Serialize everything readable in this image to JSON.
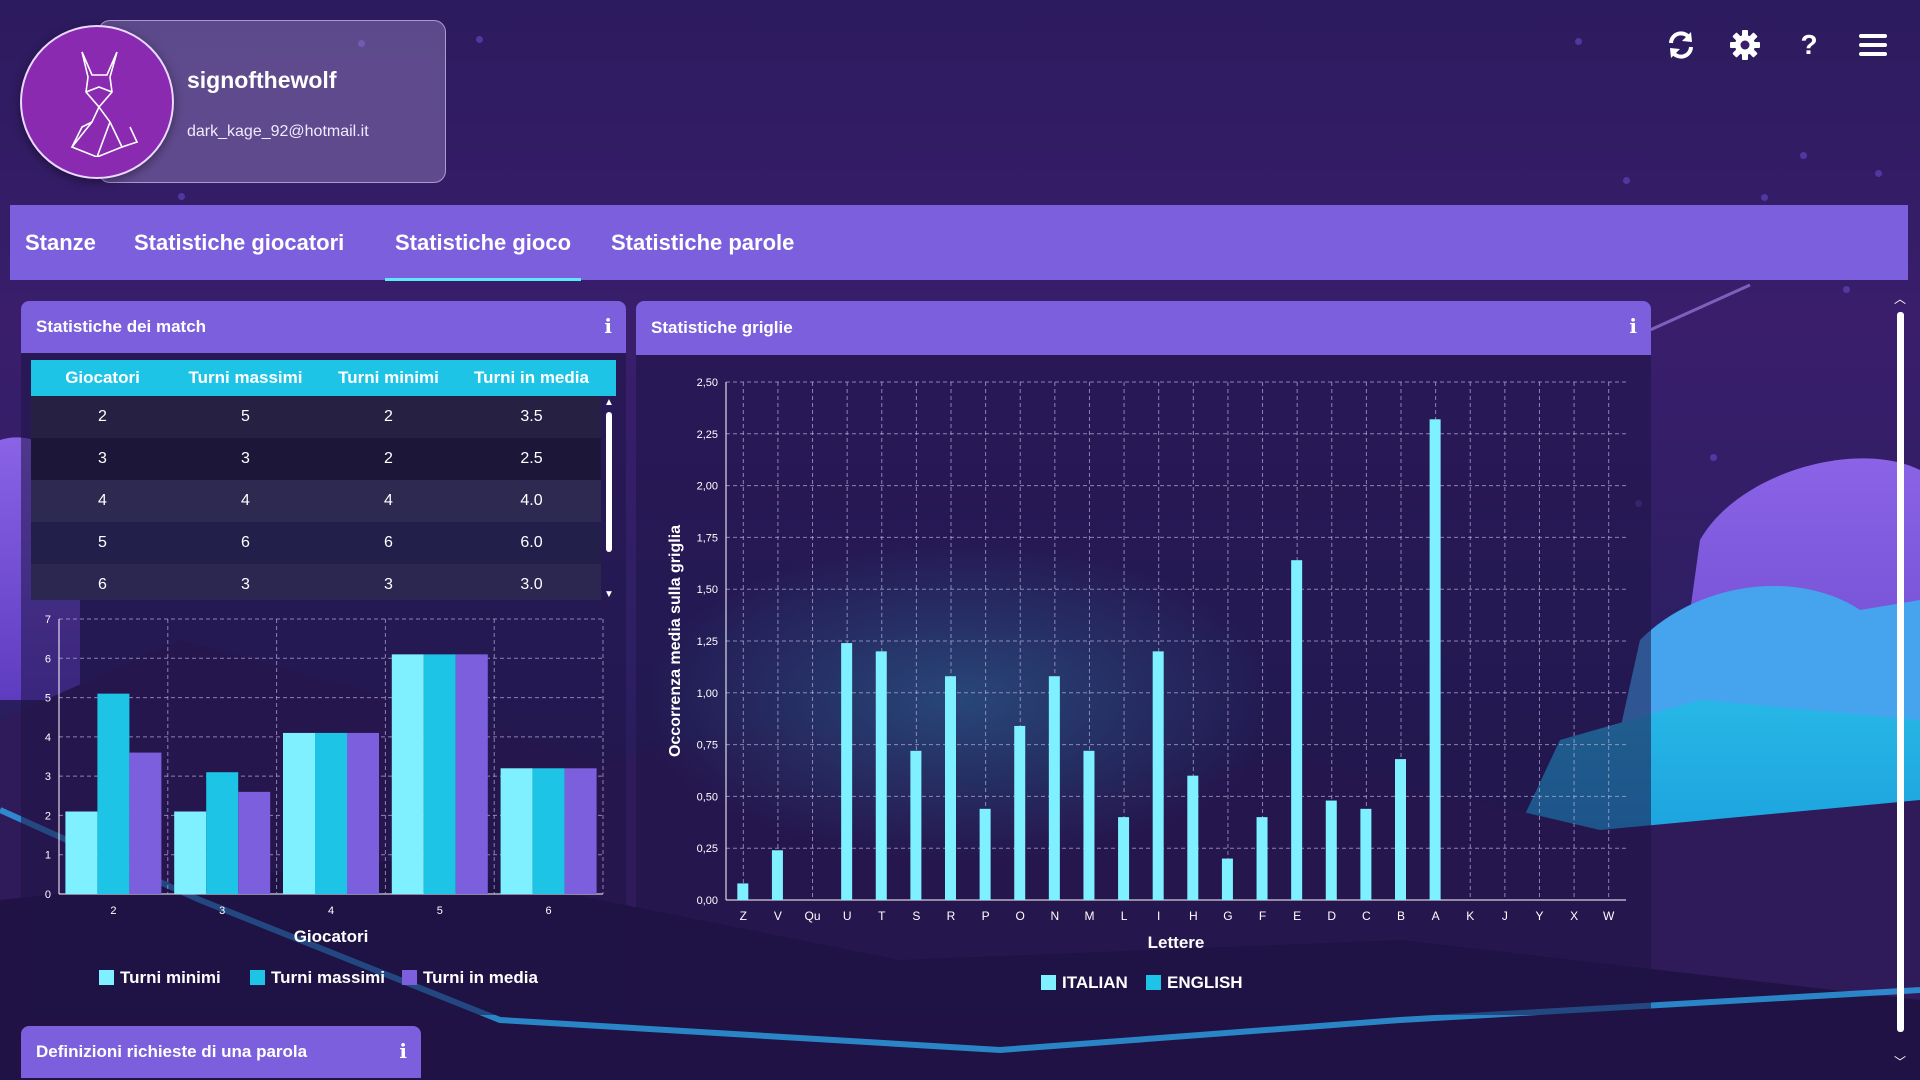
{
  "user": {
    "username": "signofthewolf",
    "email": "dark_kage_92@hotmail.it"
  },
  "top_icons": [
    "refresh-icon",
    "gear-icon",
    "help-icon",
    "menu-icon"
  ],
  "nav": {
    "tabs": [
      {
        "label": "Stanze"
      },
      {
        "label": "Statistiche giocatori"
      },
      {
        "label": "Statistiche gioco",
        "active": true
      },
      {
        "label": "Statistiche parole"
      }
    ]
  },
  "colors": {
    "nav_bg": "#7b5fdc",
    "cyan_light": "#7ff0ff",
    "cyan": "#1ec4e6",
    "purple": "#7b5fdc"
  },
  "match_panel": {
    "title": "Statistiche dei match",
    "info": "i",
    "table": {
      "headers": [
        "Giocatori",
        "Turni massimi",
        "Turni minimi",
        "Turni in media"
      ],
      "rows": [
        [
          "2",
          "5",
          "2",
          "3.5"
        ],
        [
          "3",
          "3",
          "2",
          "2.5"
        ],
        [
          "4",
          "4",
          "4",
          "4.0"
        ],
        [
          "5",
          "6",
          "6",
          "6.0"
        ],
        [
          "6",
          "3",
          "3",
          "3.0"
        ]
      ]
    }
  },
  "grid_panel": {
    "title": "Statistiche griglie",
    "info": "i"
  },
  "definitions_panel": {
    "title": "Definizioni richieste di una parola",
    "info": "i"
  },
  "chart_data": [
    {
      "type": "bar",
      "xlabel": "Giocatori",
      "ylabel": "",
      "ylim": [
        0,
        7
      ],
      "yticks": [
        0,
        1,
        2,
        3,
        4,
        5,
        6,
        7
      ],
      "categories": [
        "2",
        "3",
        "4",
        "5",
        "6"
      ],
      "series": [
        {
          "name": "Turni minimi",
          "color": "#7ff0ff",
          "values": [
            2.1,
            2.1,
            4.1,
            6.1,
            3.2
          ]
        },
        {
          "name": "Turni massimi",
          "color": "#1ec4e6",
          "values": [
            5.1,
            3.1,
            4.1,
            6.1,
            3.2
          ]
        },
        {
          "name": "Turni in media",
          "color": "#7b5fdc",
          "values": [
            3.6,
            2.6,
            4.1,
            6.1,
            3.2
          ]
        }
      ],
      "grid": true,
      "legend": "bottom"
    },
    {
      "type": "bar",
      "xlabel": "Lettere",
      "ylabel": "Occorrenza media sulla griglia",
      "ylim": [
        0,
        2.5
      ],
      "yticks": [
        "0,00",
        "0,25",
        "0,50",
        "0,75",
        "1,00",
        "1,25",
        "1,50",
        "1,75",
        "2,00",
        "2,25",
        "2,50"
      ],
      "categories": [
        "Z",
        "V",
        "Qu",
        "U",
        "T",
        "S",
        "R",
        "P",
        "O",
        "N",
        "M",
        "L",
        "I",
        "H",
        "G",
        "F",
        "E",
        "D",
        "C",
        "B",
        "A",
        "K",
        "J",
        "Y",
        "X",
        "W"
      ],
      "series": [
        {
          "name": "ITALIAN",
          "color": "#7ff0ff",
          "values": [
            0.08,
            0.24,
            0,
            1.24,
            1.2,
            0.72,
            1.08,
            0.44,
            0.84,
            1.08,
            0.72,
            0.4,
            1.2,
            0.6,
            0.2,
            0.4,
            1.64,
            0.48,
            0.44,
            0.68,
            2.32,
            0,
            0,
            0,
            0,
            0
          ]
        },
        {
          "name": "ENGLISH",
          "color": "#1ec4e6",
          "values": [
            0,
            0,
            0,
            0,
            0,
            0,
            0,
            0,
            0,
            0,
            0,
            0,
            0,
            0,
            0,
            0,
            0,
            0,
            0,
            0,
            0,
            0,
            0,
            0,
            0,
            0
          ]
        }
      ],
      "grid": true,
      "legend": "bottom"
    }
  ]
}
